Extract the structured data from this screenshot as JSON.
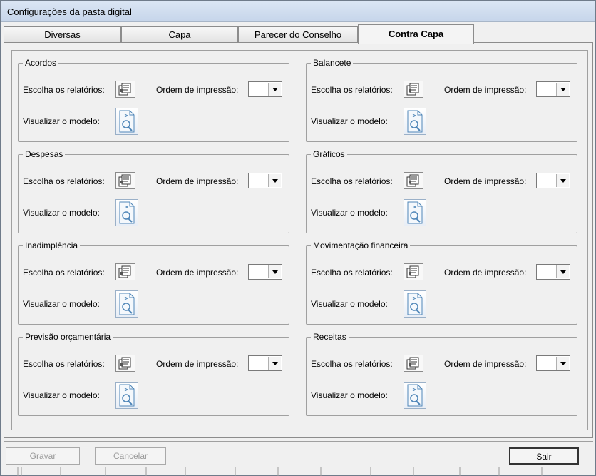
{
  "window": {
    "title": "Configurações da pasta digital"
  },
  "tabs": [
    {
      "label": "Diversas"
    },
    {
      "label": "Capa"
    },
    {
      "label": "Parecer do Conselho"
    },
    {
      "label": "Contra Capa"
    }
  ],
  "fields": {
    "choose_label": "Escolha os relatórios:",
    "order_label": "Ordem de impressão:",
    "preview_label": "Visualizar o modelo:",
    "order_value": ""
  },
  "groups": [
    {
      "title": "Acordos"
    },
    {
      "title": "Balancete"
    },
    {
      "title": "Despesas"
    },
    {
      "title": "Gráficos"
    },
    {
      "title": "Inadimplência"
    },
    {
      "title": "Movimentação financeira"
    },
    {
      "title": "Previsão orçamentária"
    },
    {
      "title": "Receitas"
    }
  ],
  "footer": {
    "save_label": "Gravar",
    "cancel_label": "Cancelar",
    "exit_label": "Sair"
  },
  "icons": {
    "report_select": "report-select-icon",
    "preview": "document-preview-icon",
    "dropdown": "chevron-down-icon"
  },
  "colors": {
    "titlebar": "#c6d5ea",
    "background": "#f0f0f0",
    "border": "#a0a0a0"
  }
}
